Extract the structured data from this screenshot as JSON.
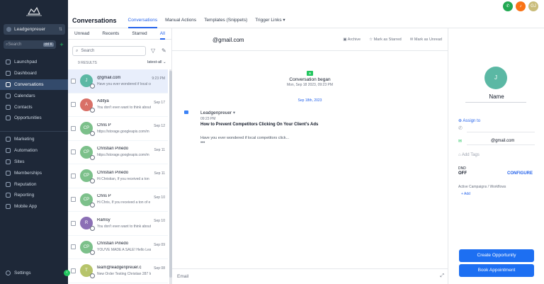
{
  "colors": {
    "sidebar": "#1e2838",
    "accent": "#2563eb",
    "primary_button": "#1d6ff2",
    "green": "#22c55e"
  },
  "sidebar": {
    "account": "Leadgenpreuer",
    "search_placeholder": "Search",
    "search_shortcut": "ctrl K",
    "items_top": [
      {
        "label": "Launchpad",
        "icon": "rocket-icon"
      },
      {
        "label": "Dashboard",
        "icon": "dashboard-icon"
      },
      {
        "label": "Conversations",
        "icon": "chat-icon"
      },
      {
        "label": "Calendars",
        "icon": "calendar-icon"
      },
      {
        "label": "Contacts",
        "icon": "contacts-icon"
      },
      {
        "label": "Opportunities",
        "icon": "opportunities-icon"
      }
    ],
    "items_bottom": [
      {
        "label": "Marketing",
        "icon": "megaphone-icon"
      },
      {
        "label": "Automation",
        "icon": "automation-icon"
      },
      {
        "label": "Sites",
        "icon": "globe-icon"
      },
      {
        "label": "Memberships",
        "icon": "membership-icon"
      },
      {
        "label": "Reputation",
        "icon": "star-icon"
      },
      {
        "label": "Reporting",
        "icon": "chart-icon"
      },
      {
        "label": "Mobile App",
        "icon": "phone-icon"
      }
    ],
    "settings": "Settings"
  },
  "topbar": {
    "title": "Conversations",
    "tabs": [
      "Conversations",
      "Manual Actions",
      "Templates (Snippets)",
      "Trigger Links"
    ],
    "avatar_initials": "GJ"
  },
  "list": {
    "filters": [
      "Unread",
      "Recents",
      "Starred",
      "All"
    ],
    "search_placeholder": "Search",
    "results": "9 RESULTS",
    "sort": "latest-all",
    "items": [
      {
        "initials": "J",
        "name": "@gmail.com",
        "preview": "Have you ever wondered if local co",
        "date": "9:23 PM",
        "color": "#5bb8a4"
      },
      {
        "initials": "A",
        "name": "Aditya",
        "preview": "You don't even want to think about",
        "date": "Sep 17",
        "color": "#d97067"
      },
      {
        "initials": "CP",
        "name": "Chris P",
        "preview": "https://storage.googleapis.com/m",
        "date": "Sep 12",
        "color": "#7cc08a"
      },
      {
        "initials": "CP",
        "name": "Christian Pinedo",
        "preview": "https://storage.googleapis.com/m",
        "date": "Sep 11",
        "color": "#7cc08a"
      },
      {
        "initials": "CP",
        "name": "Christian Pinedo",
        "preview": "Hi Christian, If you received a ton",
        "date": "Sep 11",
        "color": "#7cc08a"
      },
      {
        "initials": "CP",
        "name": "Chris P",
        "preview": "Hi Chris, If you received a ton of e",
        "date": "Sep 10",
        "color": "#7cc08a"
      },
      {
        "initials": "R",
        "name": "Ramsy",
        "preview": "You don't even want to think about",
        "date": "Sep 10",
        "color": "#8b6fb5"
      },
      {
        "initials": "CP",
        "name": "Christian Pinedo",
        "preview": "YOU'VE MADE A SALE! Hello Leadg",
        "date": "Sep 09",
        "color": "#7cc08a"
      },
      {
        "initials": "T",
        "name": "team@leadgenpreuer.c",
        "preview": "New Order Testing Christian 287 In",
        "date": "Sep 08",
        "color": "#b6c46a"
      }
    ]
  },
  "chat": {
    "header_email": "@gmail.com",
    "actions": [
      "Archive",
      "Mark as Starred",
      "Mark as Unread"
    ],
    "began_title": "Conversation began",
    "began_date": "Mon, Sep 18 2023, 09:23 PM",
    "date_separator": "Sep 18th, 2023",
    "message": {
      "from": "Leadgenpreuer",
      "time": "09:23 PM",
      "subject": "How to Prevent Competitors Clicking On Your Client's Ads",
      "body": "Have you ever wondered if local competitors click...",
      "more": "•••"
    },
    "composer_label": "Email"
  },
  "contact": {
    "initials": "J",
    "name": "Name",
    "assign": "Assign to",
    "email": "@gmail.com",
    "tags_placeholder": "Add Tags",
    "dnd_label": "DND",
    "dnd_value": "OFF",
    "configure": "CONFIGURE",
    "campaigns_label": "Active Campaigns / Workflows",
    "add": "+ Add",
    "create_opportunity": "Create Opportunity",
    "book_appointment": "Book Appointment"
  }
}
